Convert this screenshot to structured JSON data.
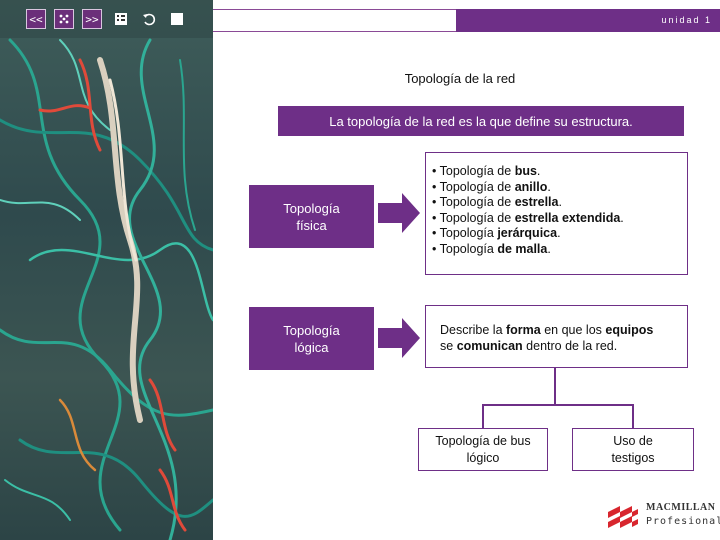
{
  "toolbar": {
    "prev": "<<",
    "next": ">>",
    "unit": "unidad 1"
  },
  "icons": [
    "previous-icon",
    "dice-icon",
    "next-icon",
    "index-icon",
    "undo-icon",
    "stop-icon"
  ],
  "colors": {
    "accent": "#6e2f87",
    "border": "#6e2f87"
  },
  "title": "Topología de la red",
  "banner": "La topología de la red es la que define su estructura.",
  "categories": {
    "fisica": [
      "Topología",
      "física"
    ],
    "logica": [
      "Topología",
      "lógica"
    ]
  },
  "physical_list": [
    {
      "prefix": "• Topología de ",
      "bold": "bus",
      "suffix": "."
    },
    {
      "prefix": "• Topología de ",
      "bold": "anillo",
      "suffix": "."
    },
    {
      "prefix": "• Topología de ",
      "bold": "estrella",
      "suffix": "."
    },
    {
      "prefix": "• Topología de ",
      "bold": "estrella extendida",
      "suffix": "."
    },
    {
      "prefix": "• Topología ",
      "bold": "jerárquica",
      "suffix": "."
    },
    {
      "prefix": "• Topología ",
      "bold": "de malla",
      "suffix": "."
    }
  ],
  "logical_desc": {
    "t1": "Describe la ",
    "b1": "forma",
    "t2": " en que los ",
    "b2": "equipos",
    "t3": "se ",
    "b3": "comunican",
    "t4": " dentro de la red."
  },
  "leaves": {
    "bus": [
      "Topología de bus",
      "lógico"
    ],
    "testigos": [
      "Uso de",
      "testigos"
    ]
  },
  "logo": {
    "line1": "MACMILLAN",
    "line2": "Profesional"
  }
}
